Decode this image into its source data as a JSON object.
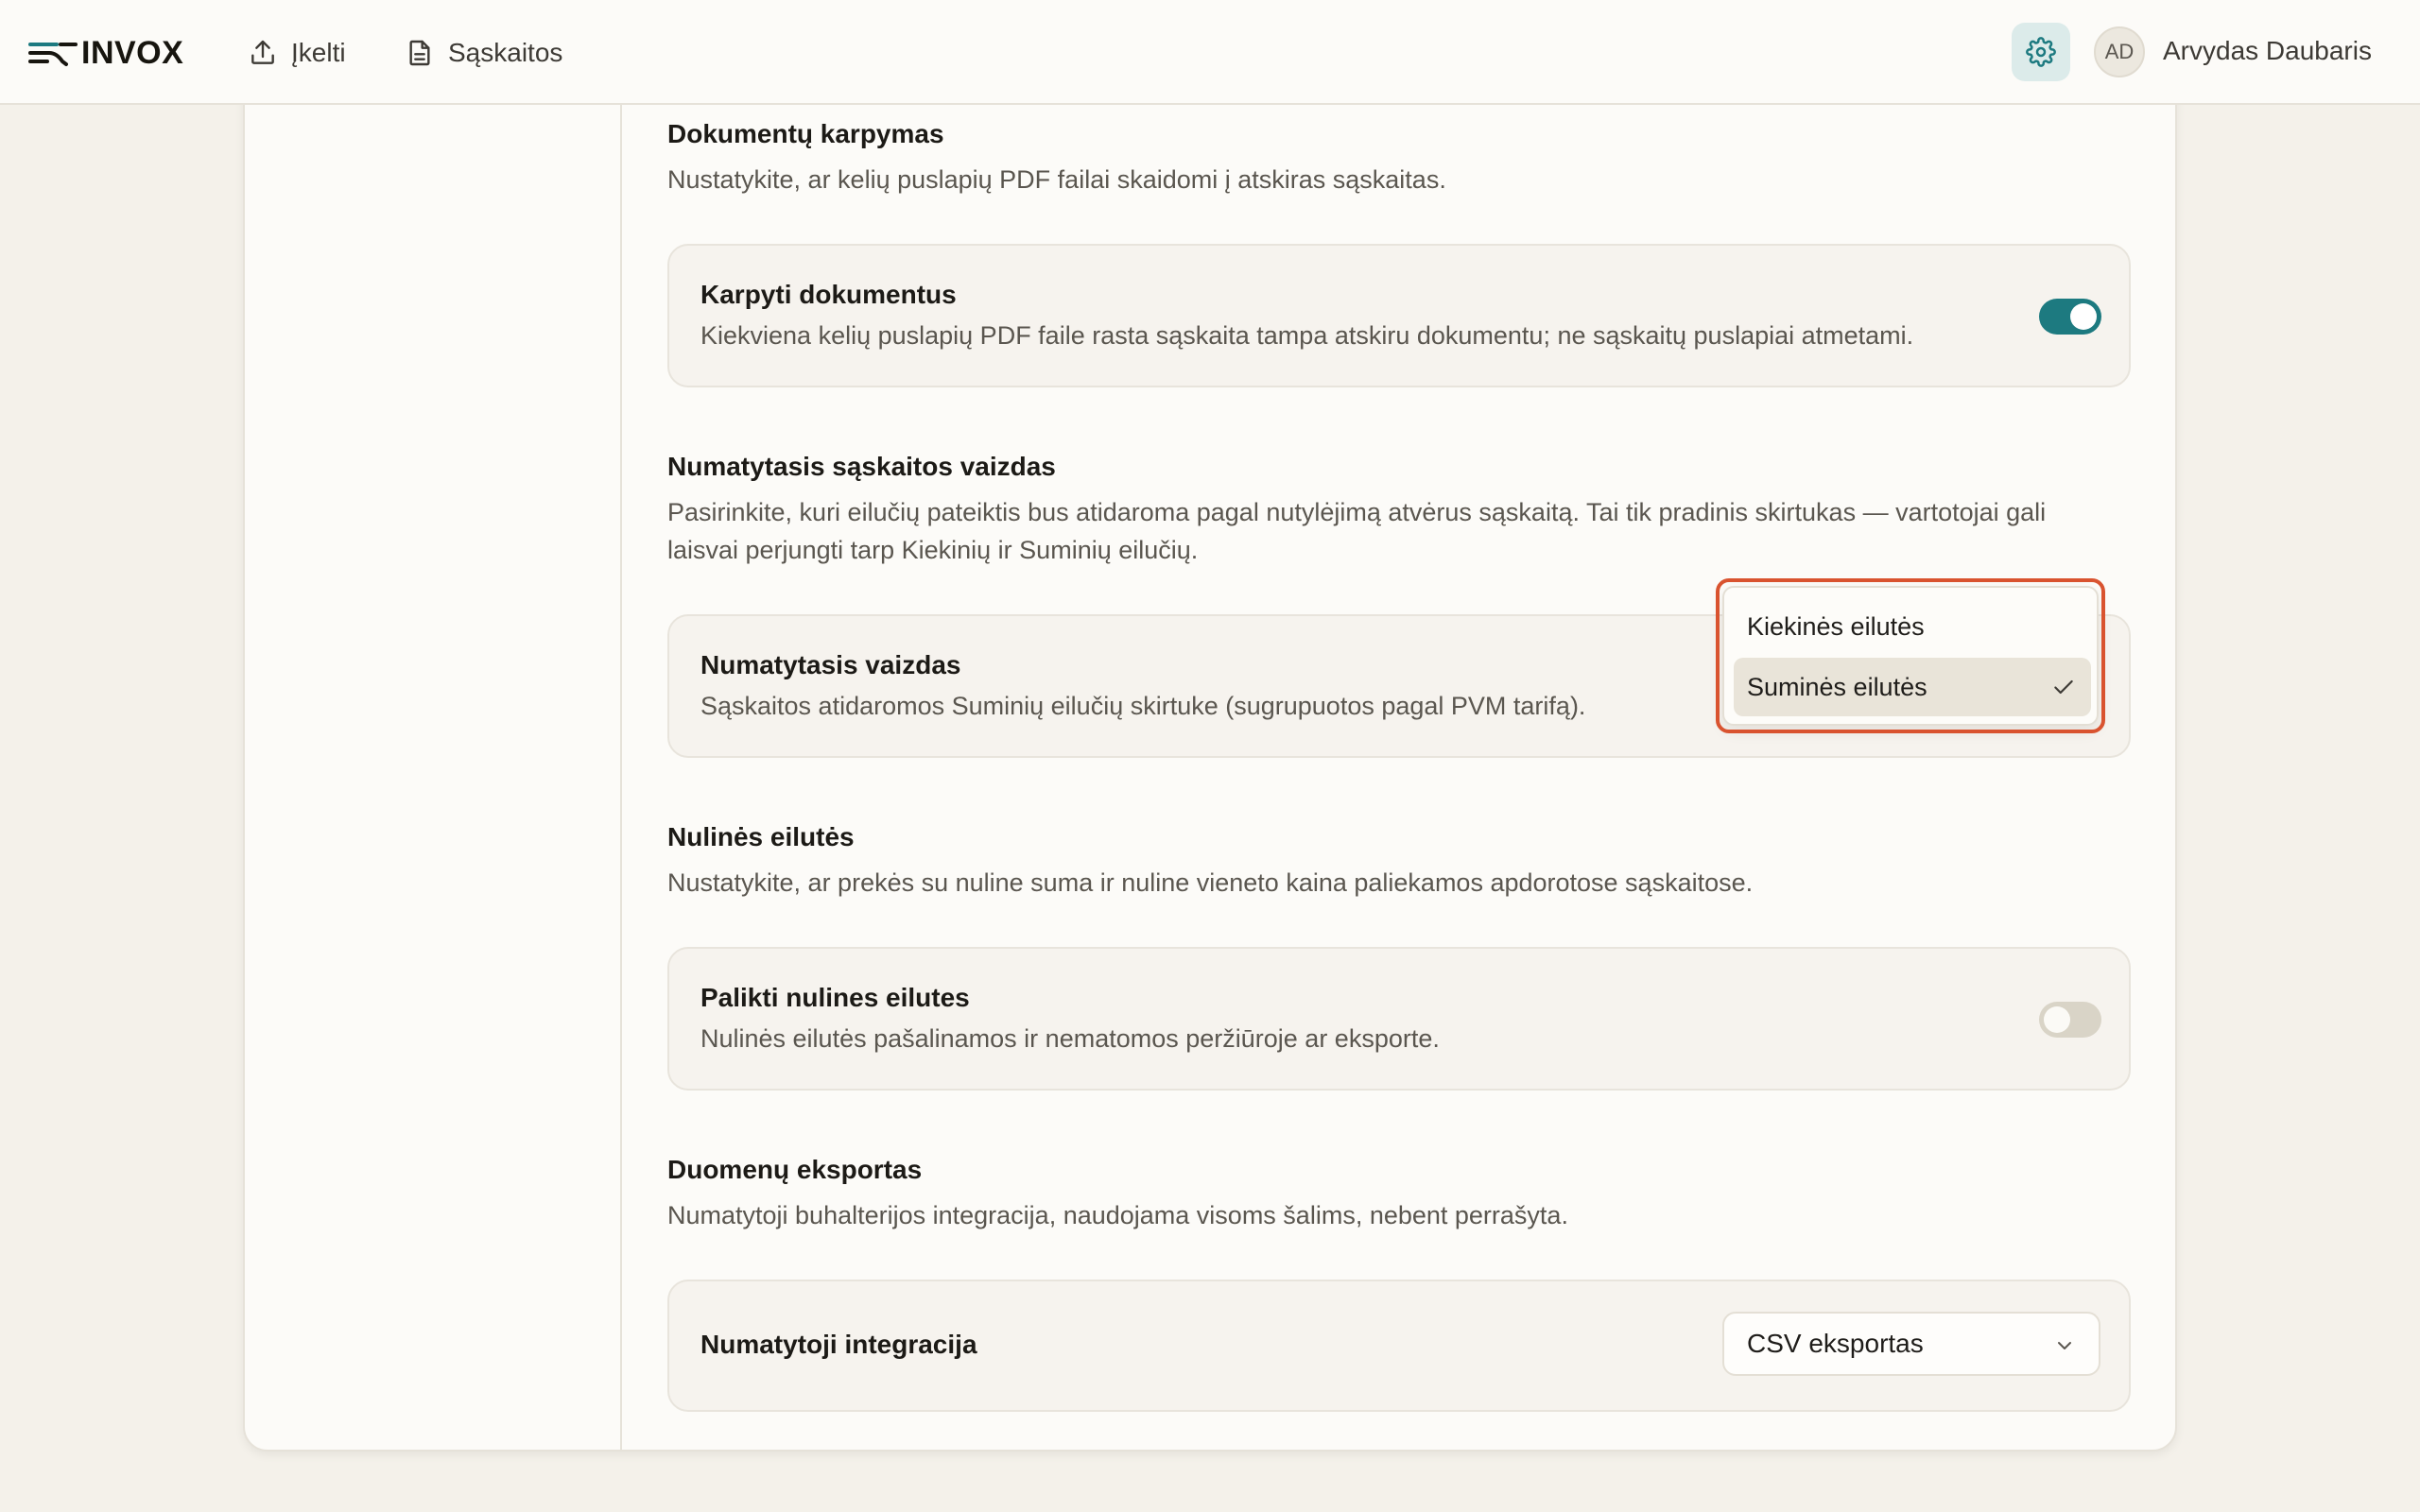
{
  "app": {
    "name": "INVOX"
  },
  "nav": {
    "upload_label": "Įkelti",
    "invoices_label": "Sąskaitos"
  },
  "user": {
    "initials": "AD",
    "name": "Arvydas Daubaris"
  },
  "colors": {
    "accent": "#1d7a80",
    "highlight": "#d9532f"
  },
  "sections": {
    "splitting": {
      "title": "Dokumentų karpymas",
      "description": "Nustatykite, ar kelių puslapių PDF failai skaidomi į atskiras sąskaitas.",
      "setting_title": "Karpyti dokumentus",
      "setting_description": "Kiekviena kelių puslapių PDF faile rasta sąskaita tampa atskiru dokumentu; ne sąskaitų puslapiai atmetami.",
      "enabled": true
    },
    "default_view": {
      "title": "Numatytasis sąskaitos vaizdas",
      "description": "Pasirinkite, kuri eilučių pateiktis bus atidaroma pagal nutylėjimą atvėrus sąskaitą. Tai tik pradinis skirtukas — vartotojai gali laisvai perjungti tarp Kiekinių ir Suminių eilučių.",
      "setting_title": "Numatytasis vaizdas",
      "setting_description": "Sąskaitos atidaromos Suminių eilučių skirtuke (sugrupuotos pagal PVM tarifą).",
      "options": [
        "Kiekinės eilutės",
        "Suminės eilutės"
      ],
      "selected": "Suminės eilutės"
    },
    "zero_lines": {
      "title": "Nulinės eilutės",
      "description": "Nustatykite, ar prekės su nuline suma ir nuline vieneto kaina paliekamos apdorotose sąskaitose.",
      "setting_title": "Palikti nulines eilutes",
      "setting_description": "Nulinės eilutės pašalinamos ir nematomos peržiūroje ar eksporte.",
      "enabled": false
    },
    "export": {
      "title": "Duomenų eksportas",
      "description": "Numatytoji buhalterijos integracija, naudojama visoms šalims, nebent perrašyta.",
      "setting_title": "Numatytoji integracija",
      "selected": "CSV eksportas"
    }
  }
}
